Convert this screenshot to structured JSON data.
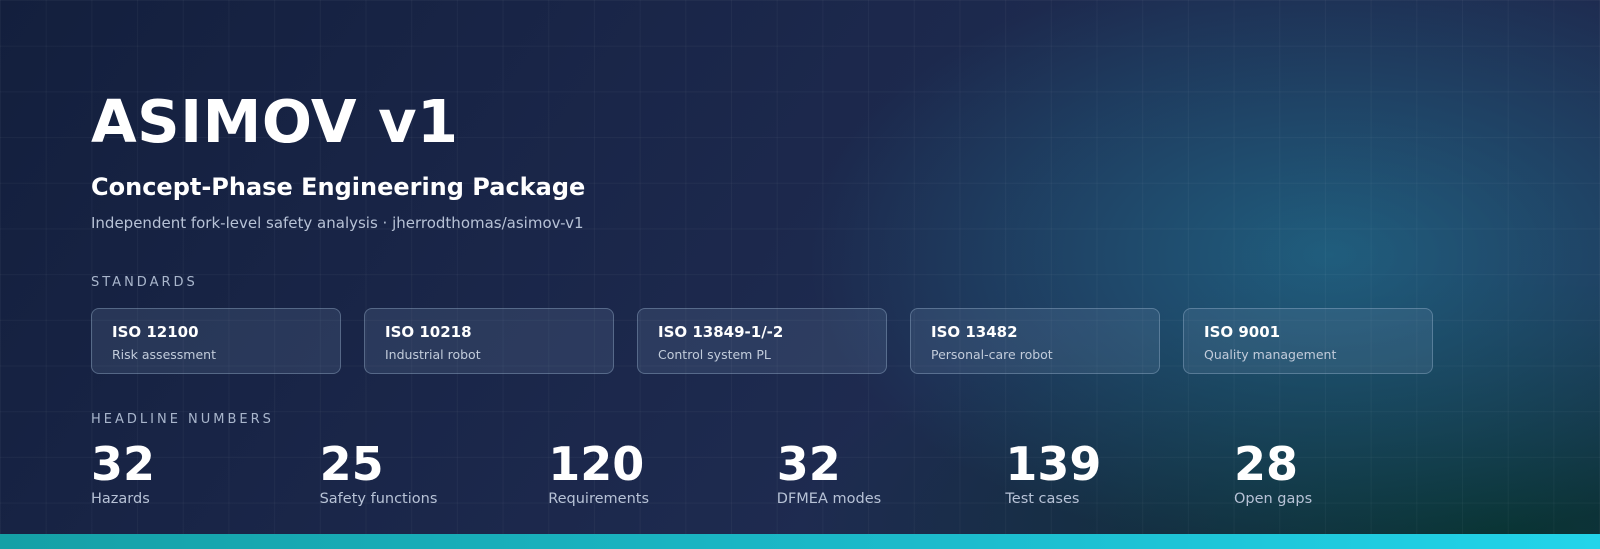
{
  "title": "ASIMOV v1",
  "subtitle": "Concept-Phase Engineering Package",
  "tagline": "Independent fork-level safety analysis · jherrodthomas/asimov-v1",
  "standards": {
    "label": "STANDARDS",
    "items": [
      {
        "name": "ISO 12100",
        "desc": "Risk assessment"
      },
      {
        "name": "ISO 10218",
        "desc": "Industrial robot"
      },
      {
        "name": "ISO 13849-1/-2",
        "desc": "Control system PL"
      },
      {
        "name": "ISO 13482",
        "desc": "Personal-care robot"
      },
      {
        "name": "ISO 9001",
        "desc": "Quality management"
      }
    ]
  },
  "headline": {
    "label": "HEADLINE NUMBERS",
    "stats": [
      {
        "value": "32",
        "label": "Hazards"
      },
      {
        "value": "25",
        "label": "Safety functions"
      },
      {
        "value": "120",
        "label": "Requirements"
      },
      {
        "value": "32",
        "label": "DFMEA modes"
      },
      {
        "value": "139",
        "label": "Test cases"
      },
      {
        "value": "28",
        "label": "Open gaps"
      }
    ]
  },
  "colors": {
    "background_dark": "#131f3d",
    "accent": "#1cbccd",
    "text_primary": "#ffffff",
    "text_muted": "#b7c2d6"
  }
}
